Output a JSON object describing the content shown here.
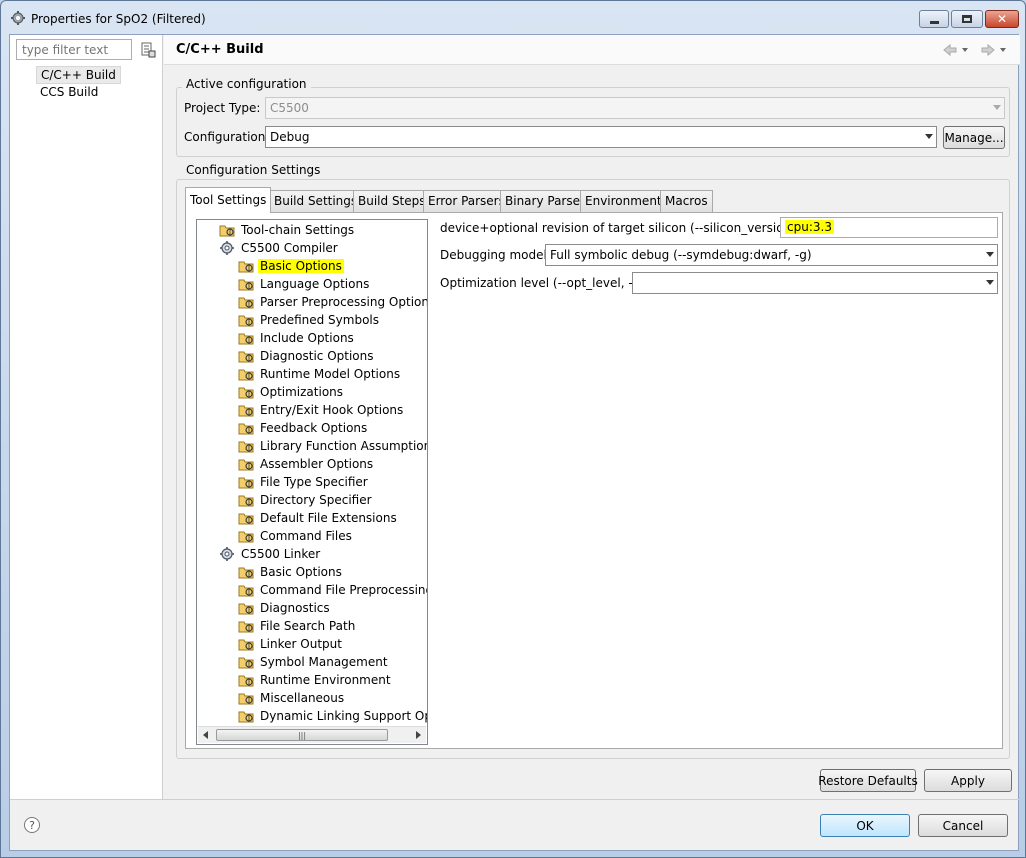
{
  "window": {
    "title": "Properties for SpO2 (Filtered)",
    "icon": "gear-icon",
    "controls": {
      "minimize": "minimize-icon",
      "maximize": "maximize-icon",
      "close": "close-icon"
    }
  },
  "left_panel": {
    "filter_placeholder": "type filter text",
    "items": [
      {
        "label": "C/C++ Build",
        "selected": true
      },
      {
        "label": "CCS Build",
        "selected": false
      }
    ]
  },
  "header": {
    "title": "C/C++ Build"
  },
  "active_configuration": {
    "group_label": "Active configuration",
    "project_type_label": "Project Type:",
    "project_type_value": "C5500",
    "configuration_label": "Configuration:",
    "configuration_value": "Debug",
    "manage_label": "Manage..."
  },
  "config_settings": {
    "group_label": "Configuration Settings",
    "tabs": [
      "Tool Settings",
      "Build Settings",
      "Build Steps",
      "Error Parsers",
      "Binary Parser",
      "Environment",
      "Macros"
    ],
    "active_tab": "Tool Settings"
  },
  "tree": {
    "items": [
      {
        "label": "Tool-chain Settings",
        "level": 0,
        "highlight": false
      },
      {
        "label": "C5500 Compiler",
        "level": 0,
        "highlight": false
      },
      {
        "label": "Basic Options",
        "level": 1,
        "highlight": true
      },
      {
        "label": "Language Options",
        "level": 1,
        "highlight": false
      },
      {
        "label": "Parser Preprocessing Options",
        "level": 1,
        "highlight": false
      },
      {
        "label": "Predefined Symbols",
        "level": 1,
        "highlight": false
      },
      {
        "label": "Include Options",
        "level": 1,
        "highlight": false
      },
      {
        "label": "Diagnostic Options",
        "level": 1,
        "highlight": false
      },
      {
        "label": "Runtime Model Options",
        "level": 1,
        "highlight": false
      },
      {
        "label": "Optimizations",
        "level": 1,
        "highlight": false
      },
      {
        "label": "Entry/Exit Hook Options",
        "level": 1,
        "highlight": false
      },
      {
        "label": "Feedback Options",
        "level": 1,
        "highlight": false
      },
      {
        "label": "Library Function Assumptions",
        "level": 1,
        "highlight": false
      },
      {
        "label": "Assembler Options",
        "level": 1,
        "highlight": false
      },
      {
        "label": "File Type Specifier",
        "level": 1,
        "highlight": false
      },
      {
        "label": "Directory Specifier",
        "level": 1,
        "highlight": false
      },
      {
        "label": "Default File Extensions",
        "level": 1,
        "highlight": false
      },
      {
        "label": "Command Files",
        "level": 1,
        "highlight": false
      },
      {
        "label": "C5500 Linker",
        "level": 0,
        "highlight": false
      },
      {
        "label": "Basic Options",
        "level": 1,
        "highlight": false
      },
      {
        "label": "Command File Preprocessing",
        "level": 1,
        "highlight": false
      },
      {
        "label": "Diagnostics",
        "level": 1,
        "highlight": false
      },
      {
        "label": "File Search Path",
        "level": 1,
        "highlight": false
      },
      {
        "label": "Linker Output",
        "level": 1,
        "highlight": false
      },
      {
        "label": "Symbol Management",
        "level": 1,
        "highlight": false
      },
      {
        "label": "Runtime Environment",
        "level": 1,
        "highlight": false
      },
      {
        "label": "Miscellaneous",
        "level": 1,
        "highlight": false
      },
      {
        "label": "Dynamic Linking Support Optio",
        "level": 1,
        "highlight": false
      }
    ]
  },
  "options": {
    "silicon_label": "device+optional revision of target silicon (--silicon_version, -v)",
    "silicon_value": "cpu:3.3",
    "debug_label": "Debugging model",
    "debug_value": "Full symbolic debug (--symdebug:dwarf, -g)",
    "opt_label": "Optimization level (--opt_level, -O)",
    "opt_value": ""
  },
  "buttons": {
    "restore_defaults": "Restore Defaults",
    "apply": "Apply",
    "ok": "OK",
    "cancel": "Cancel"
  },
  "colors": {
    "highlight": "#ffff00",
    "titlebar": "#c5d6ea"
  }
}
